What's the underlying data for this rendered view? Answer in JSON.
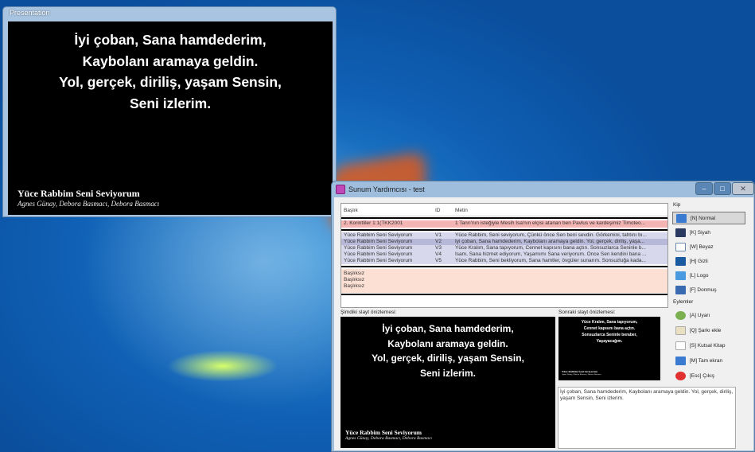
{
  "presentation_window": {
    "title": "Presentation",
    "lyrics": [
      "İyi çoban, Sana hamdederim,",
      "Kaybolanı aramaya geldin.",
      "Yol, gerçek, diriliş, yaşam Sensin,",
      "Seni izlerim."
    ],
    "song_title": "Yüce Rabbim Seni Seviyorum",
    "authors": "Agnes Günay, Debora Basmacı, Debora Basmacı"
  },
  "main_window": {
    "title": "Sunum Yardımcısı - test",
    "table": {
      "columns": [
        "Başlık",
        "ID",
        "Metin"
      ],
      "highlight_row": {
        "title": "2. Korintliler 1:1(TKK2001",
        "id": "",
        "text": "1 Tanrı'nın isteğiyle Mesih İsa'nın elçisi atanan ben Pavlus ve kardeşimiz Timoteo..."
      },
      "song_rows": [
        {
          "title": "Yüce Rabbim Seni Seviyorum",
          "id": "V1",
          "text": "Yüce Rabbim, Seni seviyorum, Çünkü önce Sen beni sevdin. Görkemini, tahtını bı..."
        },
        {
          "title": "Yüce Rabbim Seni Seviyorum",
          "id": "V2",
          "text": "İyi çoban, Sana hamdederim, Kaybolanı aramaya geldin. Yol, gerçek, diriliş, yaşa..."
        },
        {
          "title": "Yüce Rabbim Seni Seviyorum",
          "id": "V3",
          "text": "Yüce Kralım, Sana tapıyorum, Cennet kapısını bana açtın. Sonsuzlarca Seninle b..."
        },
        {
          "title": "Yüce Rabbim Seni Seviyorum",
          "id": "V4",
          "text": "İsam, Sana hizmet ediyorum, Yaşamımı Sana veriyorum. Önce Sen kendini bana ..."
        },
        {
          "title": "Yüce Rabbim Seni Seviyorum",
          "id": "V5",
          "text": "Yüce Rabbim, Seni bekliyorum, Sana hamtler, övgüler sunarım. Sonsuzluğa kada..."
        }
      ],
      "untitled_rows": [
        "Başlıksız",
        "Başlıksız",
        "Başlıksız"
      ]
    },
    "current_preview_label": "Şimdiki slayt önizlemesi:",
    "next_preview_label": "Sonraki slayt önizlemesi:",
    "current_preview": {
      "lyrics": [
        "İyi çoban, Sana hamdederim,",
        "Kaybolanı aramaya geldin.",
        "Yol, gerçek, diriliş, yaşam Sensin,",
        "Seni izlerim."
      ],
      "song_title": "Yüce Rabbim Seni Seviyorum",
      "authors": "Agnes Günay, Debora Basmacı, Debora Basmacı"
    },
    "next_preview": {
      "lyrics": [
        "Yüce Kralım, Sana tapıyorum,",
        "Cennet kapısını bana açtın.",
        "Sonsuzlarca Seninle beraber,",
        "Yaşayacağım."
      ],
      "song_title": "Yüce Rabbim Seni Seviyorum",
      "authors": "Agnes Günay, Debora Basmacı, Debora Basmacı"
    },
    "next_text": "İyi çoban, Sana hamdederim, Kaybolanı aramaya geldin. Yol, gerçek, diriliş, yaşam Sensin, Seni izlerim.",
    "mode_group": {
      "label": "Kip",
      "buttons": [
        "[N] Normal",
        "[K] Siyah",
        "[W] Beyaz",
        "[H] Gizli",
        "[L] Logo",
        "[F] Donmuş"
      ],
      "selected": "[N] Normal"
    },
    "actions_group": {
      "label": "Eylemler",
      "buttons": [
        "[A] Uyarı",
        "[Q] Şarkı ekle",
        "[S] Kutsal Kitap",
        "[M] Tam ekran",
        "[Esc] Çıkış"
      ]
    }
  },
  "colors": {
    "highlight_row": "#f4b4b4",
    "song_rows": "#d8d8ec",
    "selected_row": "#b8b8d8",
    "untitled_rows": "#fde0d4"
  }
}
